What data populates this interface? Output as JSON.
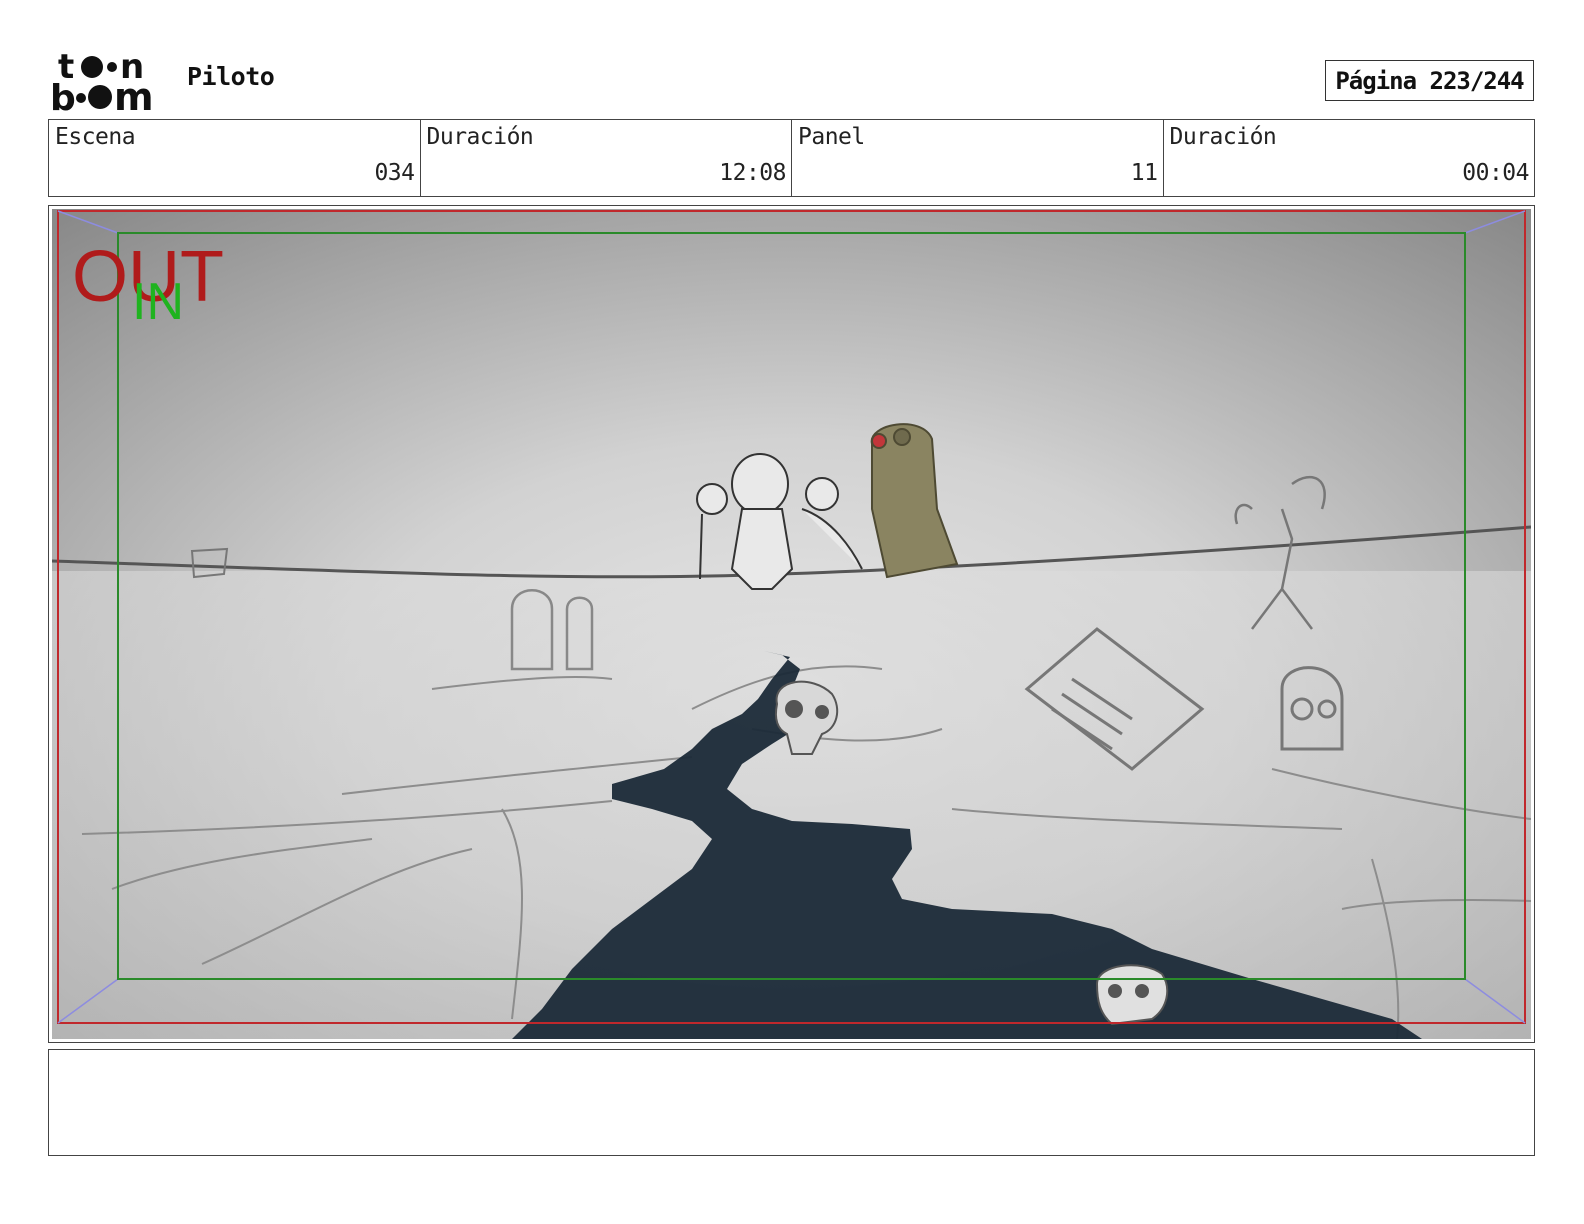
{
  "header": {
    "logo_text": "toon boom",
    "project_title": "Piloto",
    "page_label": "Página 223/244"
  },
  "info": [
    {
      "label": "Escena",
      "value": "034"
    },
    {
      "label": "Duración",
      "value": "12:08"
    },
    {
      "label": "Panel",
      "value": "11"
    },
    {
      "label": "Duración",
      "value": "00:04"
    }
  ],
  "panel": {
    "out_marker": "OUT",
    "in_marker": "IN",
    "colors": {
      "out_frame": "#c0282c",
      "in_frame": "#2a8a2a",
      "river": "#1b2a38",
      "statue": "#8a8461"
    }
  },
  "notes": {
    "text": ""
  }
}
